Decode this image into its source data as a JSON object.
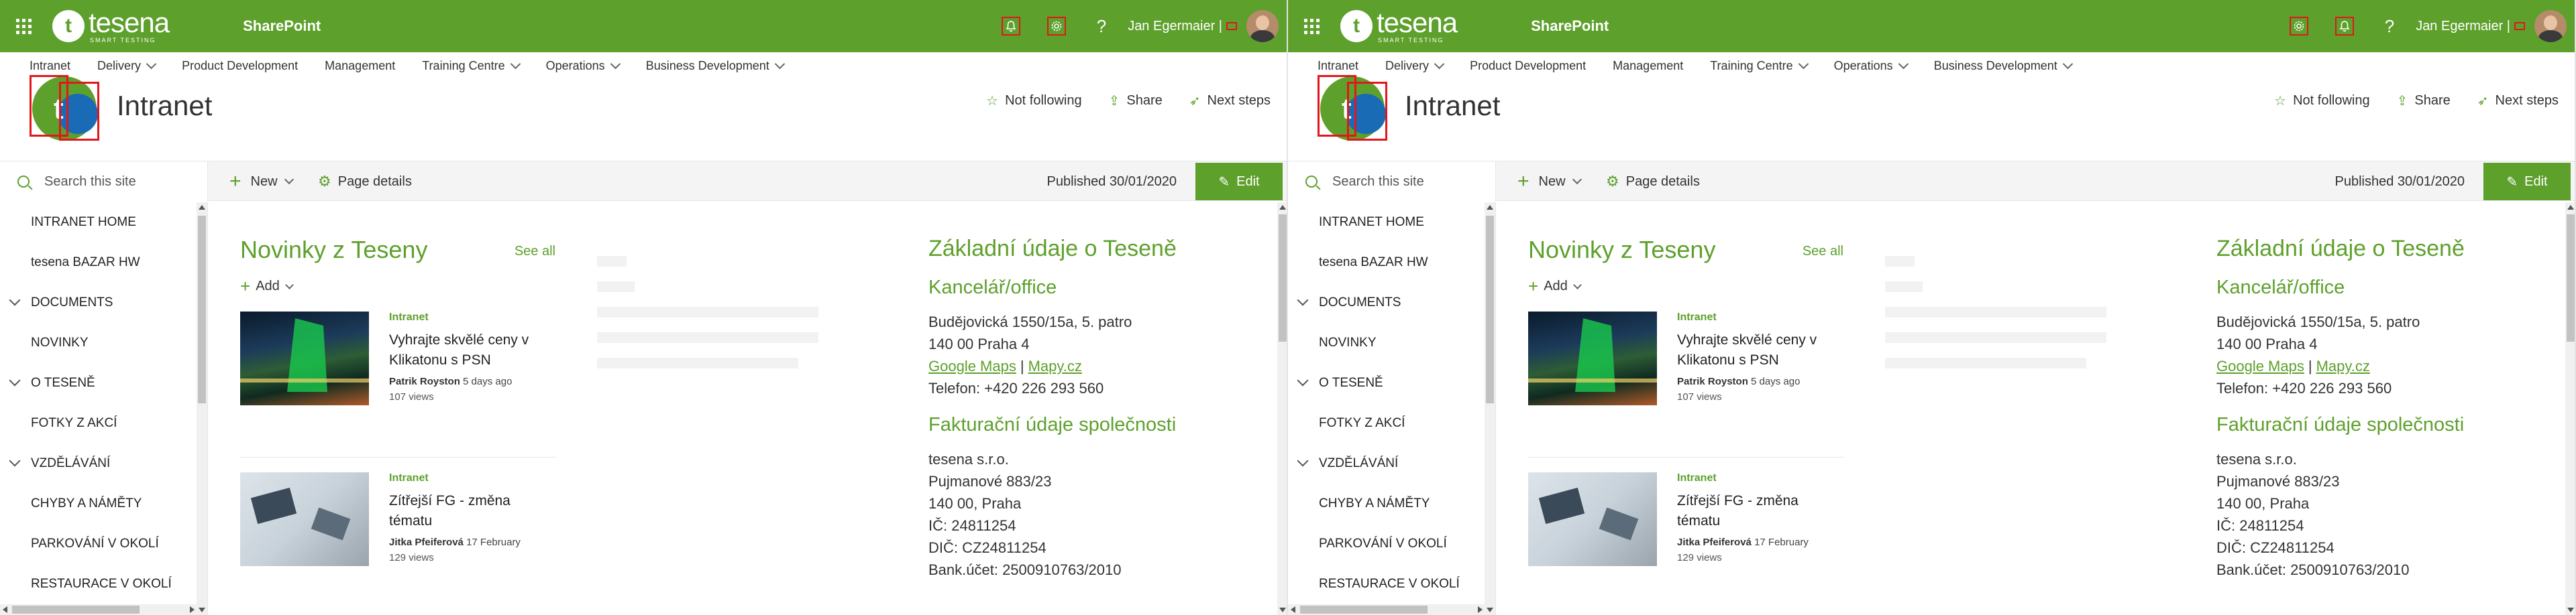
{
  "suite": {
    "brand_name": "tesena",
    "brand_tagline": "SMART TESTING",
    "brand_mark": "t",
    "app_name": "SharePoint",
    "user_name": "Jan Egermaier |",
    "help_glyph": "?",
    "icons": [
      "waffle-icon",
      "bell-icon",
      "gear-icon",
      "help-icon",
      "flag-icon",
      "avatar"
    ]
  },
  "topnav": {
    "items": [
      {
        "label": "Intranet",
        "has_menu": false
      },
      {
        "label": "Delivery",
        "has_menu": true
      },
      {
        "label": "Product Development",
        "has_menu": false
      },
      {
        "label": "Management",
        "has_menu": false
      },
      {
        "label": "Training Centre",
        "has_menu": true
      },
      {
        "label": "Operations",
        "has_menu": true
      },
      {
        "label": "Business Development",
        "has_menu": true
      }
    ]
  },
  "site": {
    "title": "Intranet",
    "logo_letter": "t",
    "actions": {
      "follow": "Not following",
      "share": "Share",
      "next_steps": "Next steps"
    }
  },
  "cmdbar": {
    "search_placeholder": "Search this site",
    "new_label": "New",
    "page_details_label": "Page details",
    "published": "Published 30/01/2020",
    "edit_label": "Edit"
  },
  "leftnav": {
    "items": [
      {
        "label": "INTRANET HOME",
        "expandable": false
      },
      {
        "label": "tesena BAZAR HW",
        "expandable": false
      },
      {
        "label": "DOCUMENTS",
        "expandable": true
      },
      {
        "label": "NOVINKY",
        "expandable": false
      },
      {
        "label": "O TESENĚ",
        "expandable": true
      },
      {
        "label": "FOTKY Z AKCÍ",
        "expandable": false
      },
      {
        "label": "VZDĚLÁVÁNÍ",
        "expandable": true
      },
      {
        "label": "CHYBY A NÁMĚTY",
        "expandable": false
      },
      {
        "label": "PARKOVÁNÍ V OKOLÍ",
        "expandable": false
      },
      {
        "label": "RESTAURACE V OKOLÍ",
        "expandable": false
      }
    ]
  },
  "news": {
    "title": "Novinky z Teseny",
    "see_all": "See all",
    "add_label": "Add",
    "posts": [
      {
        "category": "Intranet",
        "title": "Vyhrajte skvělé ceny v Klikatonu s PSN",
        "author": "Patrik Royston",
        "date": "5 days ago",
        "views": "107 views"
      },
      {
        "category": "Intranet",
        "title": "Zítřejší FG - změna tématu",
        "author": "Jitka Pfeiferová",
        "date": "17 February",
        "views": "129 views"
      }
    ]
  },
  "info": {
    "heading": "Základní údaje o Teseně",
    "office_heading": "Kancelář/office",
    "office_address1": "Budějovická 1550/15a, 5. patro",
    "office_address2": "140 00 Praha 4",
    "maps_google": "Google Maps",
    "maps_separator": "|",
    "maps_mapy": "Mapy.cz",
    "phone": "Telefon: +420 226 293 560",
    "billing_heading": "Fakturační údaje společnosti",
    "company": "tesena s.r.o.",
    "billing_address1": "Pujmanové 883/23",
    "billing_address2": "140 00, Praha",
    "ico": "IČ: 24811254",
    "dic": "DIČ: CZ24811254",
    "bank": "Bank.účet: 2500910763/2010"
  },
  "colors": {
    "accent": "#5ea02c",
    "highlight_box": "#e2161b",
    "site_logo_blue": "#1a6bb5"
  }
}
